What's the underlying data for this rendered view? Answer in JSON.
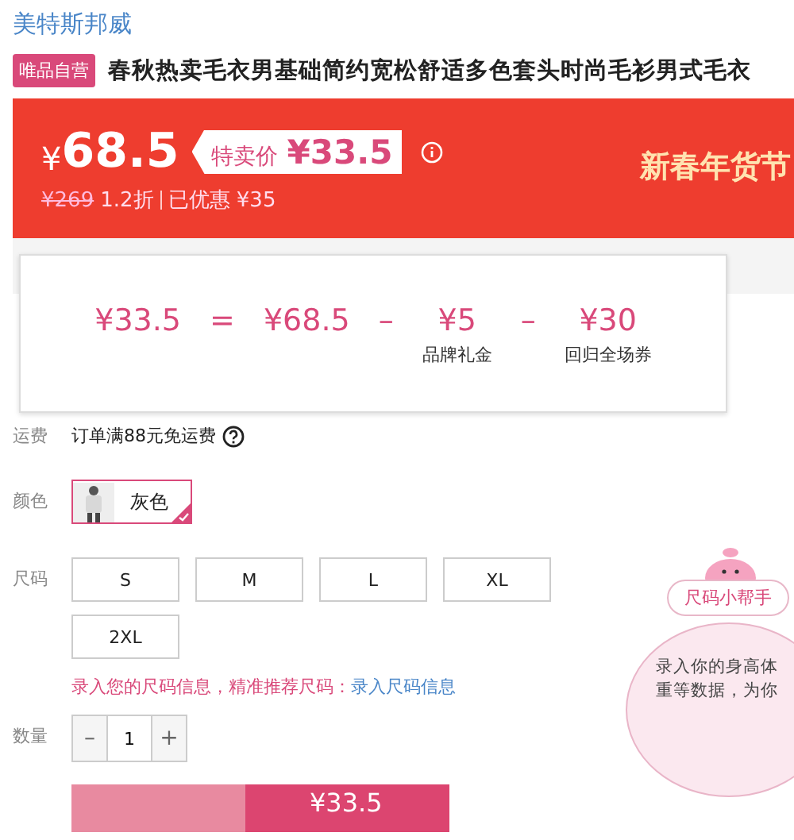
{
  "brand": "美特斯邦威",
  "product": {
    "badge": "唯品自营",
    "title": "春秋热卖毛衣男基础简约宽松舒适多色套头时尚毛衫男式毛衣"
  },
  "price_banner": {
    "currency": "¥",
    "price": "68.5",
    "special_label": "特卖价",
    "special_price": "¥33.5",
    "original_price": "¥269",
    "discount": "1.2折",
    "saved": "已优惠 ¥35",
    "promo": "新春年货节"
  },
  "price_breakdown": [
    {
      "amount": "¥33.5"
    },
    {
      "operator": "=",
      "amount": "¥68.5"
    },
    {
      "operator": "–",
      "amount": "¥5",
      "caption": "品牌礼金"
    },
    {
      "operator": "–",
      "amount": "¥30",
      "caption": "回归全场券"
    }
  ],
  "shipping": {
    "label": "运费",
    "text": "订单满88元免运费"
  },
  "color": {
    "label": "颜色",
    "options": [
      {
        "name": "灰色",
        "selected": true
      }
    ]
  },
  "size": {
    "label": "尺码",
    "options": [
      {
        "name": "S",
        "selected": false
      },
      {
        "name": "M",
        "selected": false
      },
      {
        "name": "L",
        "selected": false
      },
      {
        "name": "XL",
        "selected": false
      },
      {
        "name": "2XL",
        "selected": false
      }
    ],
    "hint": "录入您的尺码信息，精准推荐尺码：",
    "hint_link": "录入尺码信息"
  },
  "quantity": {
    "label": "数量",
    "minus": "–",
    "value": "1",
    "plus": "+"
  },
  "buy_button": {
    "price": "¥33.5"
  },
  "size_helper": {
    "title": "尺码小帮手",
    "lines": [
      "录入你的身高体",
      "重等数据，为你"
    ]
  }
}
